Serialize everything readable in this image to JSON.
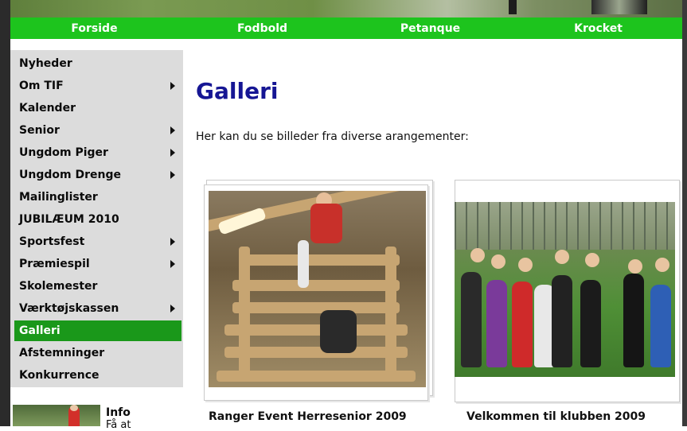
{
  "nav": {
    "tabs": [
      "Forside",
      "Fodbold",
      "Petanque",
      "Krocket"
    ]
  },
  "sidebar": {
    "items": [
      {
        "label": "Nyheder",
        "has_submenu": false,
        "active": false
      },
      {
        "label": "Om TIF",
        "has_submenu": true,
        "active": false
      },
      {
        "label": "Kalender",
        "has_submenu": false,
        "active": false
      },
      {
        "label": "Senior",
        "has_submenu": true,
        "active": false
      },
      {
        "label": "Ungdom Piger",
        "has_submenu": true,
        "active": false
      },
      {
        "label": "Ungdom Drenge",
        "has_submenu": true,
        "active": false
      },
      {
        "label": "Mailinglister",
        "has_submenu": false,
        "active": false
      },
      {
        "label": "JUBILÆUM 2010",
        "has_submenu": false,
        "active": false
      },
      {
        "label": "Sportsfest",
        "has_submenu": true,
        "active": false
      },
      {
        "label": "Præmiespil",
        "has_submenu": true,
        "active": false
      },
      {
        "label": "Skolemester",
        "has_submenu": false,
        "active": false
      },
      {
        "label": "Værktøjskassen",
        "has_submenu": true,
        "active": false
      },
      {
        "label": "Galleri",
        "has_submenu": false,
        "active": true
      },
      {
        "label": "Afstemninger",
        "has_submenu": false,
        "active": false
      },
      {
        "label": "Konkurrence",
        "has_submenu": false,
        "active": false
      }
    ],
    "info": {
      "title": "Info",
      "sub": "Få at"
    }
  },
  "main": {
    "title": "Galleri",
    "intro": "Her kan du se billeder fra diverse arangementer:",
    "galleries": [
      {
        "caption": "Ranger Event Herresenior 2009"
      },
      {
        "caption": "Velkommen til klubben 2009"
      }
    ]
  },
  "colors": {
    "nav_green": "#1dc41d",
    "active_green": "#1a981a",
    "title_blue": "#161694",
    "sidebar_bg": "#dcdcdc"
  }
}
